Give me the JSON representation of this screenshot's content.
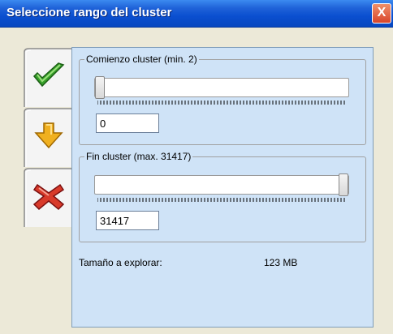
{
  "window": {
    "title": "Seleccione rango del cluster",
    "close_symbol": "X"
  },
  "tabs": [
    {
      "name": "accept",
      "icon": "checkmark-icon"
    },
    {
      "name": "download",
      "icon": "down-arrow-icon"
    },
    {
      "name": "cancel",
      "icon": "red-x-icon"
    }
  ],
  "start_group": {
    "legend": "Comienzo cluster (min. 2)",
    "slider_fraction": 0,
    "value": "0"
  },
  "end_group": {
    "legend": "Fin cluster (max. 31417)",
    "slider_fraction": 1,
    "value": "31417"
  },
  "footer": {
    "label": "Tamaño a explorar:",
    "value": "123 MB"
  },
  "colors": {
    "panel_bg": "#cfe3f7",
    "titlebar": "#0a4fd0"
  }
}
